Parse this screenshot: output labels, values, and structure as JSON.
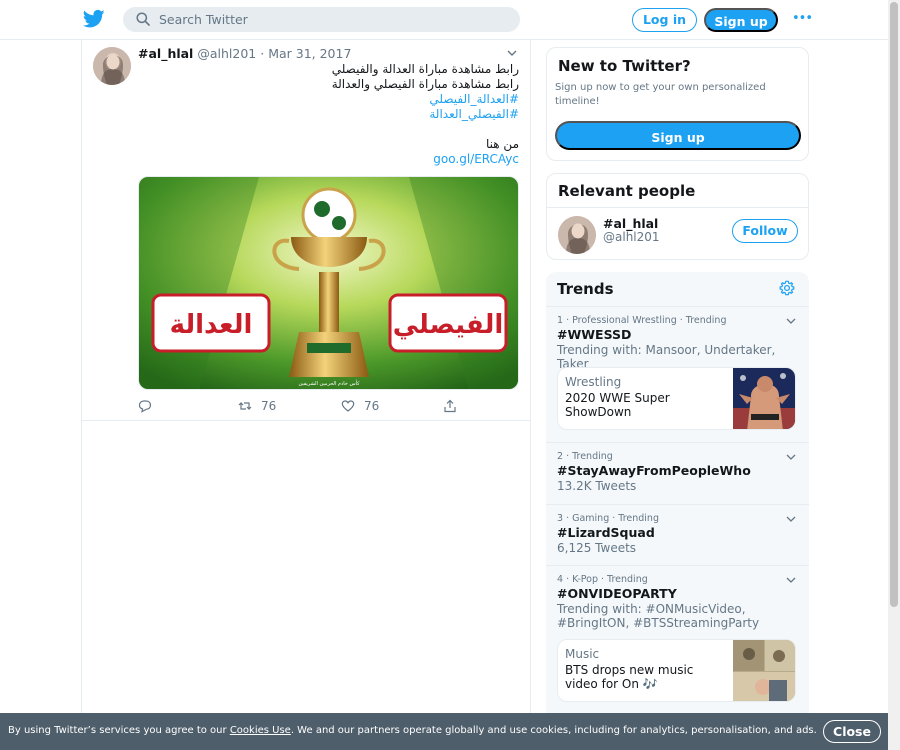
{
  "brand": {
    "accent": "#1da1f2",
    "logo_icon": "twitter-bird-icon"
  },
  "search": {
    "placeholder": "Search Twitter"
  },
  "header": {
    "login_label": "Log in",
    "signup_label": "Sign up",
    "more_icon": "more-dots-icon",
    "more_glyph": "•••"
  },
  "tweet": {
    "name": "#al_hlal",
    "handle": "@alhl201",
    "separator": "·",
    "date": "Mar 31, 2017",
    "lines": [
      "رابط مشاهدة مباراة العدالة والفيصلي",
      "رابط مشاهدة مباراة الفيصلي والعدالة"
    ],
    "hashtags": [
      "#العدالة_الفيصلي",
      "#الفيصلي_العدالة"
    ],
    "from_here": "من هنا",
    "link": "goo.gl/ERCAyc",
    "media": {
      "left_label": "العدالة",
      "right_label": "الفيصلي",
      "caption": "كأس خادم الحرمين الشريفين"
    },
    "retweets": "76",
    "likes": "76"
  },
  "new_to_twitter": {
    "title": "New to Twitter?",
    "subtitle": "Sign up now to get your own personalized timeline!",
    "signup_label": "Sign up"
  },
  "relevant_people": {
    "title": "Relevant people",
    "name": "#al_hlal",
    "handle": "@alhl201",
    "follow_label": "Follow"
  },
  "trends": {
    "title": "Trends",
    "items": [
      {
        "meta": "1 · Professional Wrestling · Trending",
        "title": "#WWESSD",
        "desc": "Trending with: Mansoor, Undertaker, Taker",
        "card": {
          "kind": "Wrestling",
          "text": "2020 WWE Super ShowDown"
        }
      },
      {
        "meta": "2 · Trending",
        "title": "#StayAwayFromPeopleWho",
        "desc": "13.2K Tweets"
      },
      {
        "meta": "3 · Gaming · Trending",
        "title": "#LizardSquad",
        "desc": "6,125 Tweets"
      },
      {
        "meta": "4 · K-Pop · Trending",
        "title": "#ONVIDEOPARTY",
        "desc": "Trending with: #ONMusicVideo, #BringItON, #BTSStreamingParty",
        "card": {
          "kind": "Music",
          "text": "BTS drops new music video for On 🎶"
        }
      }
    ]
  },
  "cookie": {
    "text_before": "By using Twitter’s services you agree to our ",
    "link": "Cookies Use",
    "text_after": ". We and our partners operate globally and use cookies, including for analytics, personalisation, and ads.",
    "close_label": "Close"
  }
}
